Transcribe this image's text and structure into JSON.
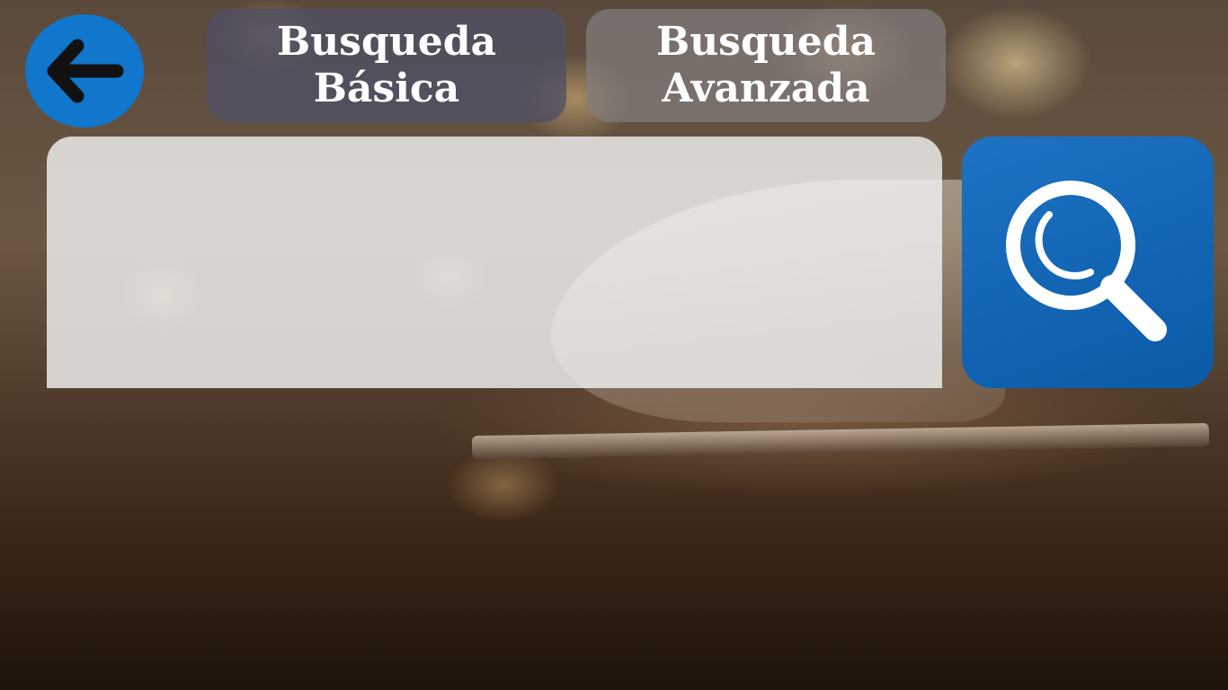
{
  "nav": {
    "back_icon": "arrow-left-icon"
  },
  "tabs": {
    "basic_label": "Busqueda\nBásica",
    "advanced_label": "Busqueda\nAvanzada"
  },
  "search": {
    "value": "",
    "placeholder": "",
    "button_icon": "magnifier-icon"
  },
  "colors": {
    "accent_blue": "#1177cc",
    "search_button_blue": "#0b5aa7",
    "tab_basic_bg": "#50506e",
    "tab_advanced_bg": "#827d7d",
    "text_white": "#ffffff"
  }
}
